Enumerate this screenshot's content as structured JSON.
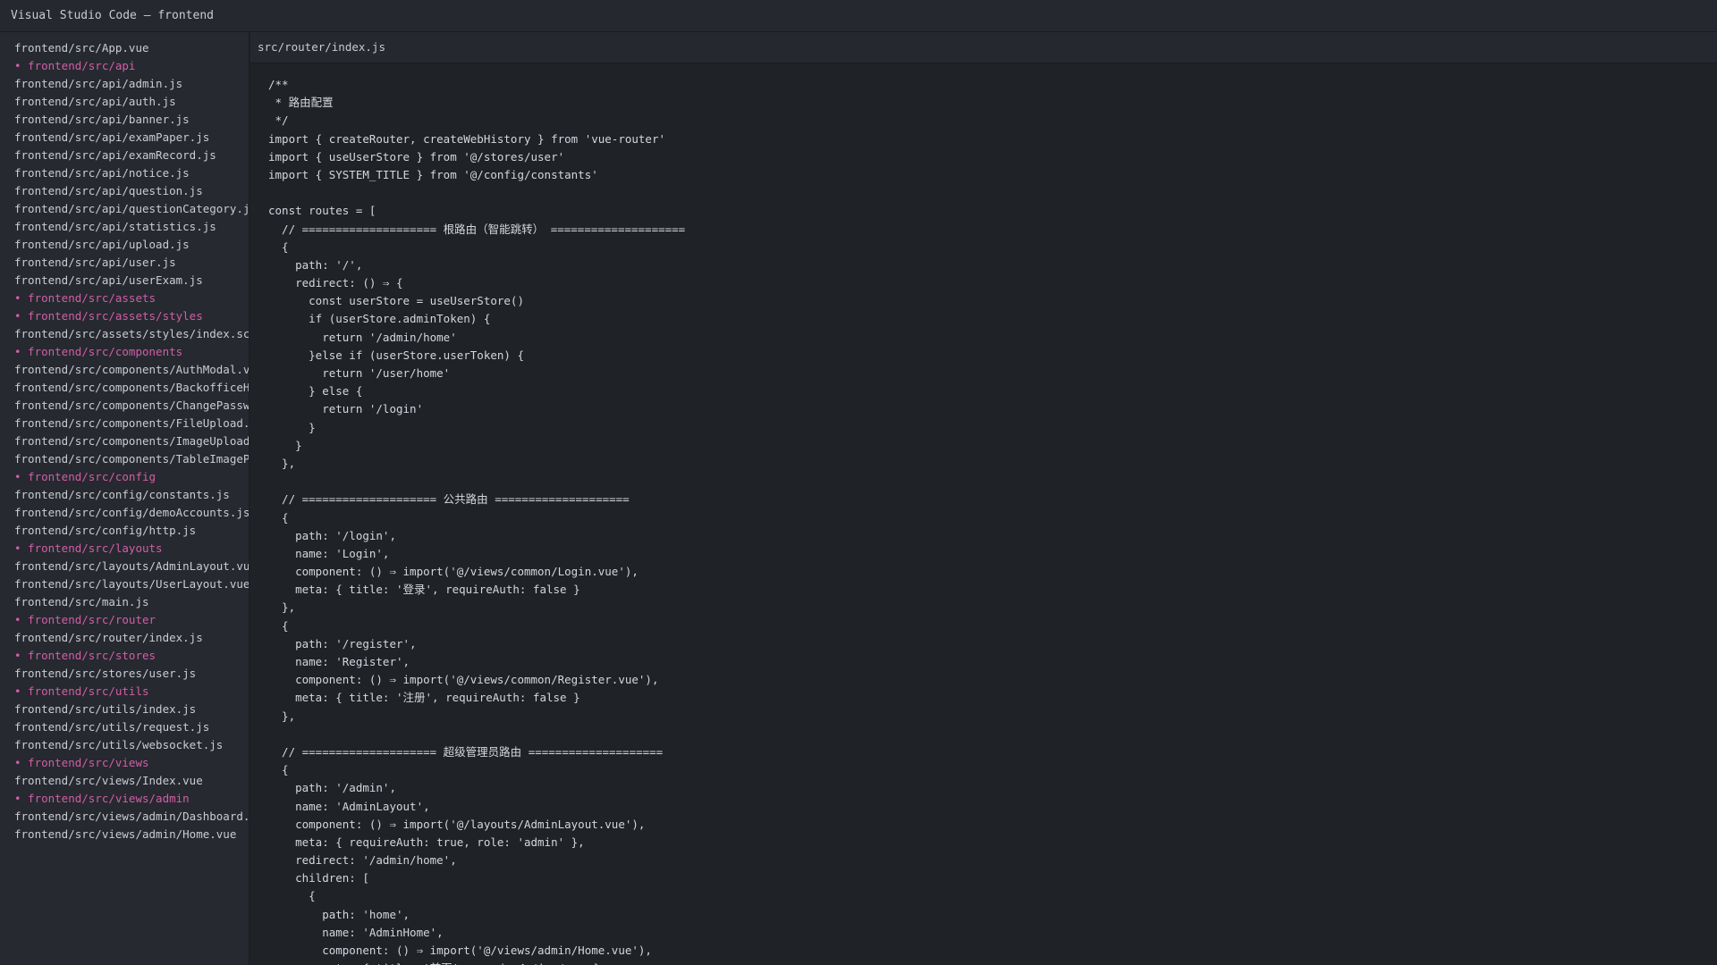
{
  "window": {
    "title": "Visual Studio Code — frontend"
  },
  "sidebar": {
    "items": [
      {
        "label": "frontend/src/App.vue",
        "folder": false
      },
      {
        "label": "• frontend/src/api",
        "folder": true
      },
      {
        "label": "frontend/src/api/admin.js",
        "folder": false
      },
      {
        "label": "frontend/src/api/auth.js",
        "folder": false
      },
      {
        "label": "frontend/src/api/banner.js",
        "folder": false
      },
      {
        "label": "frontend/src/api/examPaper.js",
        "folder": false
      },
      {
        "label": "frontend/src/api/examRecord.js",
        "folder": false
      },
      {
        "label": "frontend/src/api/notice.js",
        "folder": false
      },
      {
        "label": "frontend/src/api/question.js",
        "folder": false
      },
      {
        "label": "frontend/src/api/questionCategory.js",
        "folder": false
      },
      {
        "label": "frontend/src/api/statistics.js",
        "folder": false
      },
      {
        "label": "frontend/src/api/upload.js",
        "folder": false
      },
      {
        "label": "frontend/src/api/user.js",
        "folder": false
      },
      {
        "label": "frontend/src/api/userExam.js",
        "folder": false
      },
      {
        "label": "• frontend/src/assets",
        "folder": true
      },
      {
        "label": "• frontend/src/assets/styles",
        "folder": true
      },
      {
        "label": "frontend/src/assets/styles/index.scss",
        "folder": false
      },
      {
        "label": "• frontend/src/components",
        "folder": true
      },
      {
        "label": "frontend/src/components/AuthModal.vue",
        "folder": false
      },
      {
        "label": "frontend/src/components/BackofficeHom",
        "folder": false
      },
      {
        "label": "frontend/src/components/ChangePasswor",
        "folder": false
      },
      {
        "label": "frontend/src/components/FileUpload.vu",
        "folder": false
      },
      {
        "label": "frontend/src/components/ImageUpload.v",
        "folder": false
      },
      {
        "label": "frontend/src/components/TableImagePre",
        "folder": false
      },
      {
        "label": "• frontend/src/config",
        "folder": true
      },
      {
        "label": "frontend/src/config/constants.js",
        "folder": false
      },
      {
        "label": "frontend/src/config/demoAccounts.js",
        "folder": false
      },
      {
        "label": "frontend/src/config/http.js",
        "folder": false
      },
      {
        "label": "• frontend/src/layouts",
        "folder": true
      },
      {
        "label": "frontend/src/layouts/AdminLayout.vue",
        "folder": false
      },
      {
        "label": "frontend/src/layouts/UserLayout.vue",
        "folder": false
      },
      {
        "label": "frontend/src/main.js",
        "folder": false
      },
      {
        "label": "• frontend/src/router",
        "folder": true
      },
      {
        "label": "frontend/src/router/index.js",
        "folder": false
      },
      {
        "label": "• frontend/src/stores",
        "folder": true
      },
      {
        "label": "frontend/src/stores/user.js",
        "folder": false
      },
      {
        "label": "• frontend/src/utils",
        "folder": true
      },
      {
        "label": "frontend/src/utils/index.js",
        "folder": false
      },
      {
        "label": "frontend/src/utils/request.js",
        "folder": false
      },
      {
        "label": "frontend/src/utils/websocket.js",
        "folder": false
      },
      {
        "label": "• frontend/src/views",
        "folder": true
      },
      {
        "label": "frontend/src/views/Index.vue",
        "folder": false
      },
      {
        "label": "• frontend/src/views/admin",
        "folder": true
      },
      {
        "label": "frontend/src/views/admin/Dashboard.vu",
        "folder": false
      },
      {
        "label": "frontend/src/views/admin/Home.vue",
        "folder": false
      }
    ]
  },
  "editor": {
    "tab_label": "src/router/index.js",
    "lines": [
      "/**",
      " * 路由配置",
      " */",
      "import { createRouter, createWebHistory } from 'vue-router'",
      "import { useUserStore } from '@/stores/user'",
      "import { SYSTEM_TITLE } from '@/config/constants'",
      "",
      "const routes = [",
      "  // ==================== 根路由（智能跳转） ====================",
      "  {",
      "    path: '/',",
      "    redirect: () ⇒ {",
      "      const userStore = useUserStore()",
      "      if (userStore.adminToken) {",
      "        return '/admin/home'",
      "      }else if (userStore.userToken) {",
      "        return '/user/home'",
      "      } else {",
      "        return '/login'",
      "      }",
      "    }",
      "  },",
      "",
      "  // ==================== 公共路由 ====================",
      "  {",
      "    path: '/login',",
      "    name: 'Login',",
      "    component: () ⇒ import('@/views/common/Login.vue'),",
      "    meta: { title: '登录', requireAuth: false }",
      "  },",
      "  {",
      "    path: '/register',",
      "    name: 'Register',",
      "    component: () ⇒ import('@/views/common/Register.vue'),",
      "    meta: { title: '注册', requireAuth: false }",
      "  },",
      "",
      "  // ==================== 超级管理员路由 ====================",
      "  {",
      "    path: '/admin',",
      "    name: 'AdminLayout',",
      "    component: () ⇒ import('@/layouts/AdminLayout.vue'),",
      "    meta: { requireAuth: true, role: 'admin' },",
      "    redirect: '/admin/home',",
      "    children: [",
      "      {",
      "        path: 'home',",
      "        name: 'AdminHome',",
      "        component: () ⇒ import('@/views/admin/Home.vue'),",
      "        meta: { title: '首页', requireAuth: true }"
    ]
  }
}
